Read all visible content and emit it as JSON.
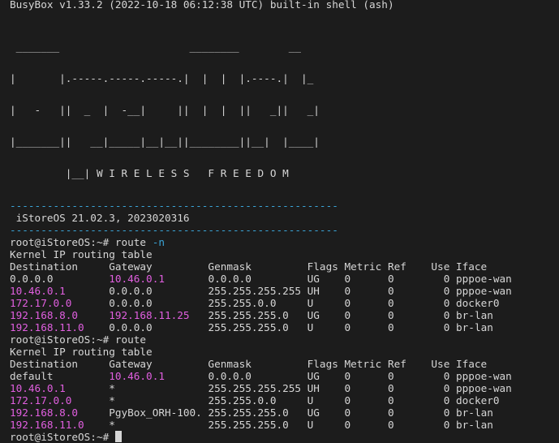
{
  "terminal": {
    "busybox_line": "BusyBox v1.33.2 (2022-10-18 06:12:38 UTC) built-in shell (ash)",
    "logo_lines": [
      " _______                     ________        __",
      "|       |.-----.-----.-----.|  |  |  |.----.|  |_",
      "|   -   ||  _  |  -__|     ||  |  |  ||   _||   _|",
      "|_______||   __|_____|__|__||________||__|  |____|",
      "         |__| W I R E L E S S   F R E E D O M"
    ],
    "separator": "-----------------------------------------------------",
    "os_version": " iStoreOS 21.02.3, 2023020316",
    "prompt": "root@iStoreOS:~#",
    "commands": [
      "route -n",
      "route"
    ],
    "table_title": "Kernel IP routing table",
    "columns": [
      "Destination",
      "Gateway",
      "Genmask",
      "Flags",
      "Metric",
      "Ref",
      "Use",
      "Iface"
    ],
    "route_n_rows": [
      {
        "dest": "0.0.0.0",
        "gw": "10.46.0.1",
        "mask": "0.0.0.0",
        "flags": "UG",
        "metric": "0",
        "ref": "0",
        "use": "0",
        "iface": "pppoe-wan"
      },
      {
        "dest": "10.46.0.1",
        "gw": "0.0.0.0",
        "mask": "255.255.255.255",
        "flags": "UH",
        "metric": "0",
        "ref": "0",
        "use": "0",
        "iface": "pppoe-wan"
      },
      {
        "dest": "172.17.0.0",
        "gw": "0.0.0.0",
        "mask": "255.255.0.0",
        "flags": "U",
        "metric": "0",
        "ref": "0",
        "use": "0",
        "iface": "docker0"
      },
      {
        "dest": "192.168.8.0",
        "gw": "192.168.11.25",
        "mask": "255.255.255.0",
        "flags": "UG",
        "metric": "0",
        "ref": "0",
        "use": "0",
        "iface": "br-lan"
      },
      {
        "dest": "192.168.11.0",
        "gw": "0.0.0.0",
        "mask": "255.255.255.0",
        "flags": "U",
        "metric": "0",
        "ref": "0",
        "use": "0",
        "iface": "br-lan"
      }
    ],
    "route_rows": [
      {
        "dest": "default",
        "gw": "10.46.0.1",
        "mask": "0.0.0.0",
        "flags": "UG",
        "metric": "0",
        "ref": "0",
        "use": "0",
        "iface": "pppoe-wan"
      },
      {
        "dest": "10.46.0.1",
        "gw": "*",
        "mask": "255.255.255.255",
        "flags": "UH",
        "metric": "0",
        "ref": "0",
        "use": "0",
        "iface": "pppoe-wan"
      },
      {
        "dest": "172.17.0.0",
        "gw": "*",
        "mask": "255.255.0.0",
        "flags": "U",
        "metric": "0",
        "ref": "0",
        "use": "0",
        "iface": "docker0"
      },
      {
        "dest": "192.168.8.0",
        "gw": "PgyBox_ORH-100.",
        "mask": "255.255.255.0",
        "flags": "UG",
        "metric": "0",
        "ref": "0",
        "use": "0",
        "iface": "br-lan"
      },
      {
        "dest": "192.168.11.0",
        "gw": "*",
        "mask": "255.255.255.0",
        "flags": "U",
        "metric": "0",
        "ref": "0",
        "use": "0",
        "iface": "br-lan"
      }
    ],
    "colors": {
      "background": "#1c1c1c",
      "foreground": "#d6d6d6",
      "magenta": "#e15fe0",
      "cyan": "#3aa5d8"
    }
  }
}
